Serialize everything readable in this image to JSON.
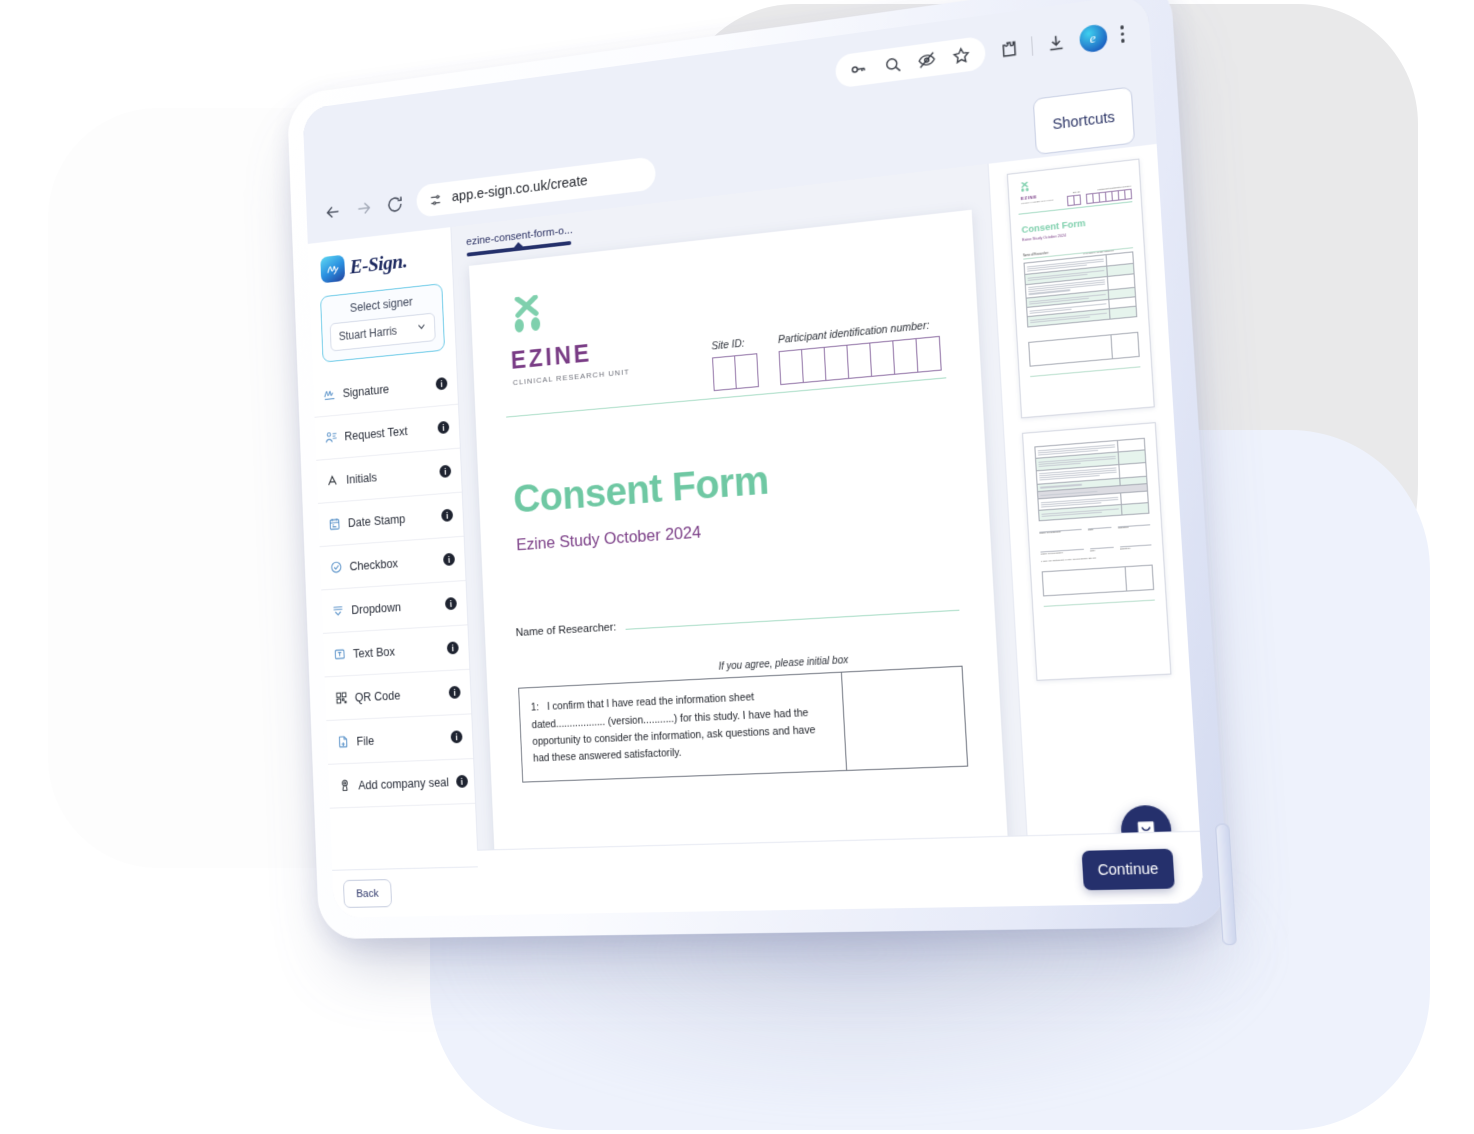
{
  "browser": {
    "url": "app.e-sign.co.uk/create",
    "nav": {
      "back_icon": "arrow-left-icon",
      "forward_icon": "arrow-right-icon",
      "reload_icon": "reload-icon",
      "site_settings_icon": "tune-sliders-icon"
    },
    "toolbar_icons": [
      "password-key-icon",
      "zoom-out-icon",
      "hide-eye-icon",
      "bookmark-star-icon",
      "extensions-puzzle-icon",
      "download-icon",
      "profile-avatar-icon",
      "kebab-menu-icon"
    ],
    "profile_initial": "e"
  },
  "app": {
    "shortcuts_label": "Shortcuts",
    "brand_name": "E-Sign.",
    "brand_mark_icon": "esign-signature-logo-icon",
    "signer": {
      "label": "Select signer",
      "value": "Stuart Harris",
      "chevron_icon": "chevron-down-icon"
    },
    "tools": [
      {
        "label": "Signature",
        "icon": "signature-icon",
        "info": "i"
      },
      {
        "label": "Request Text",
        "icon": "request-text-icon",
        "info": "i"
      },
      {
        "label": "Initials",
        "icon": "initials-a-icon",
        "info": "i"
      },
      {
        "label": "Date Stamp",
        "icon": "calendar-icon",
        "info": "i"
      },
      {
        "label": "Checkbox",
        "icon": "check-circle-icon",
        "info": "i"
      },
      {
        "label": "Dropdown",
        "icon": "dropdown-icon",
        "info": "i"
      },
      {
        "label": "Text Box",
        "icon": "text-box-icon",
        "info": "i"
      },
      {
        "label": "QR Code",
        "icon": "qr-code-icon",
        "info": "i"
      },
      {
        "label": "File",
        "icon": "file-icon",
        "info": "i"
      },
      {
        "label": "Add company seal",
        "icon": "company-seal-icon",
        "info": "i"
      }
    ],
    "back_label": "Back",
    "continue_label": "Continue",
    "chat_icon": "chat-bubble-icon",
    "document_tab": "ezine-consent-form-o..."
  },
  "document": {
    "logo_mark_icon": "ezine-dna-mark-icon",
    "org_name": "EZINE",
    "org_subtitle": "CLINICAL RESEARCH UNIT",
    "site_id_label": "Site ID:",
    "site_id_boxes": 2,
    "participant_label": "Participant identification number:",
    "participant_boxes": 7,
    "title": "Consent Form",
    "subtitle": "Ezine Study October 2024",
    "researcher_label": "Name of Researcher:",
    "initial_hint": "If you agree, please initial box",
    "consent_items": [
      {
        "number": "1:",
        "text": "I confirm that I have read the information sheet dated.................. (version...........) for this study. I have had the opportunity to consider the information, ask questions and have had these answered satisfactorily."
      }
    ]
  },
  "thumbnails": {
    "page1": {
      "org_name": "EZINE",
      "org_subtitle": "CLINICAL RESEARCH UNIT",
      "site_id_caption": "Site ID:",
      "participant_caption": "Participant identification number:",
      "title": "Consent Form",
      "subtitle": "Ezine Study October 2024",
      "researcher_label": "Name of Researcher:",
      "initial_hint": "If you agree, please initial box",
      "row_count": 6
    },
    "page2": {
      "row_count": 7,
      "signature_rows": [
        {
          "name_label": "Name of Participant",
          "date_label": "Date",
          "sign_label": "Signature"
        },
        {
          "name_label": "Name of Researcher",
          "date_label": "Date",
          "sign_label": "Signature"
        }
      ],
      "footer_note": "1 copy for participant; 1 copy for researcher site file"
    }
  },
  "colors": {
    "brand_navy": "#25306c",
    "accent_cyan": "#63c7e6",
    "doc_green": "#6fc8a3",
    "doc_purple": "#7a3d86",
    "page_bg": "#f0f2f8"
  }
}
